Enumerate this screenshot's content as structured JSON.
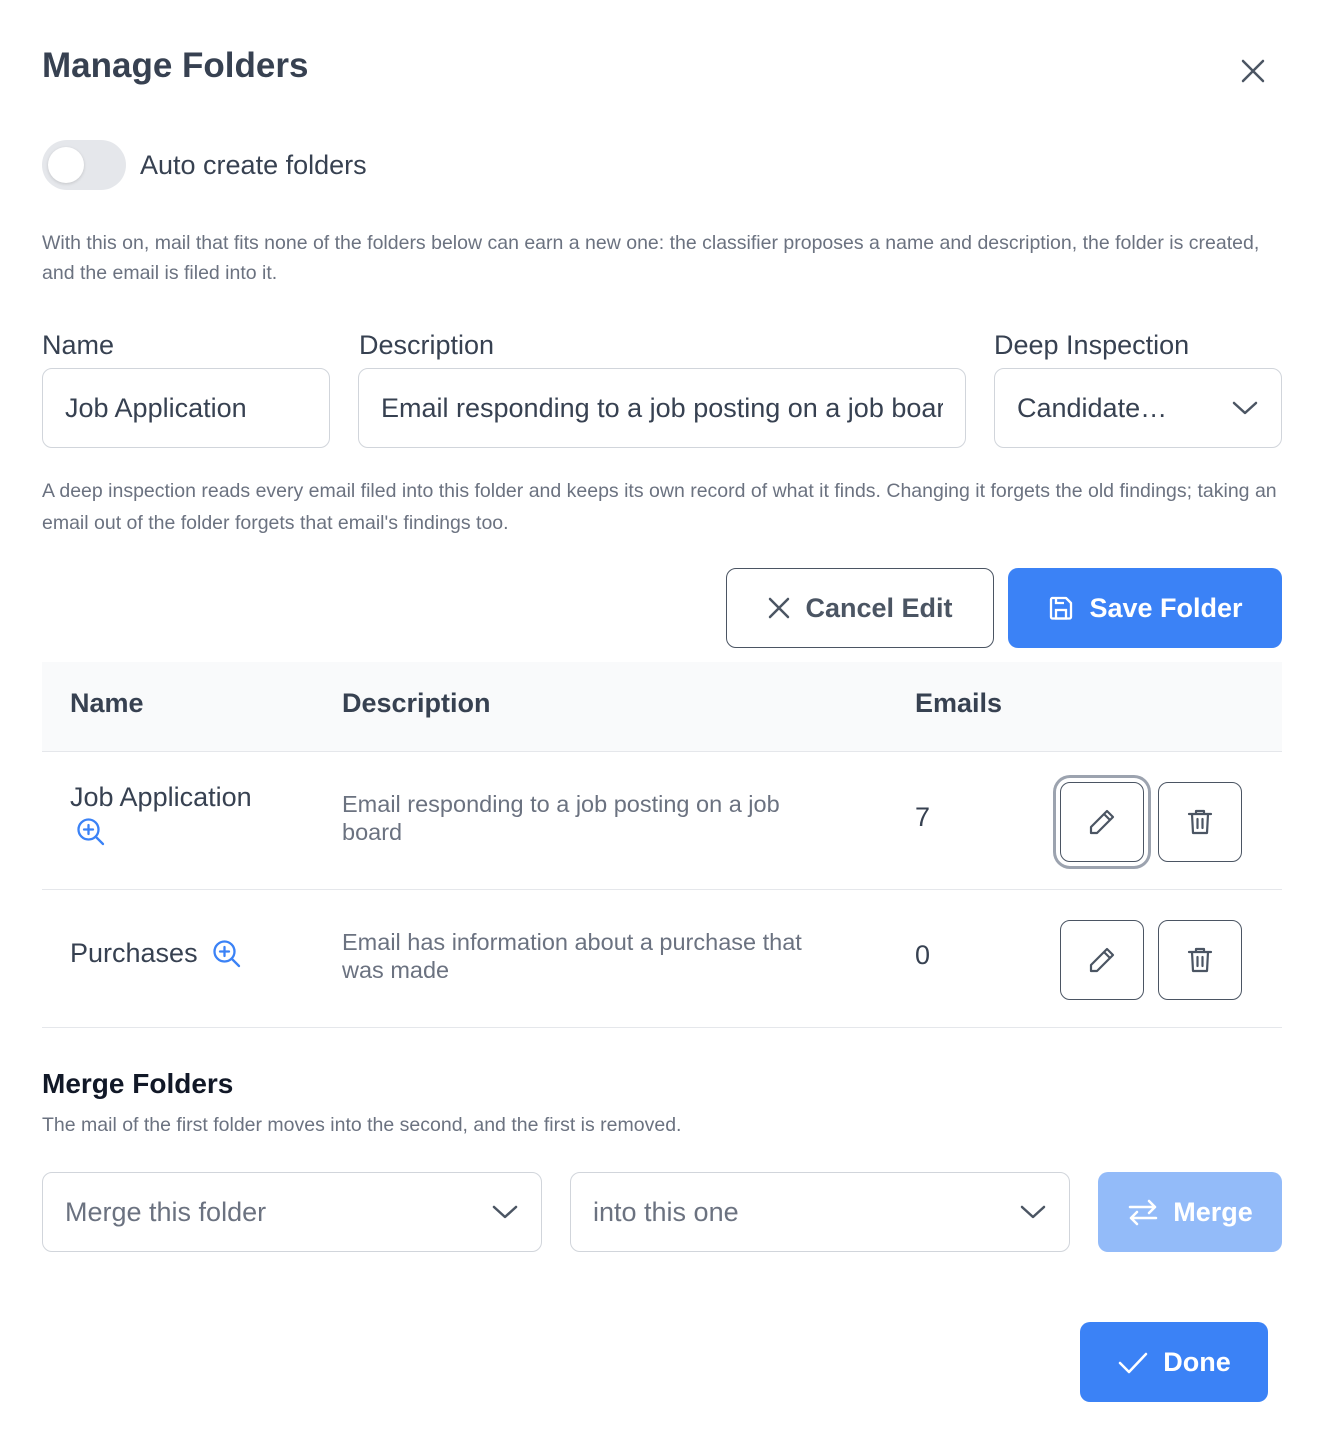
{
  "dialog": {
    "title": "Manage Folders"
  },
  "auto_create": {
    "label": "Auto create folders",
    "enabled": false,
    "help": "With this on, mail that fits none of the folders below can earn a new one: the classifier proposes a name and description, the folder is created, and the email is filed into it."
  },
  "form": {
    "name_label": "Name",
    "name_value": "Job Application",
    "description_label": "Description",
    "description_value": "Email responding to a job posting on a job board",
    "inspection_label": "Deep Inspection",
    "inspection_value": "Candidate…",
    "inspection_help": "A deep inspection reads every email filed into this folder and keeps its own record of what it finds. Changing it forgets the old findings; taking an email out of the folder forgets that email's findings too.",
    "cancel_label": "Cancel Edit",
    "save_label": "Save Folder"
  },
  "table": {
    "headers": {
      "name": "Name",
      "description": "Description",
      "emails": "Emails"
    },
    "rows": [
      {
        "name": "Job Application",
        "description": "Email responding to a job posting on a job board",
        "emails": "7"
      },
      {
        "name": "Purchases",
        "description": "Email has information about a purchase that was made",
        "emails": "0"
      }
    ]
  },
  "merge": {
    "title": "Merge Folders",
    "help": "The mail of the first folder moves into the second, and the first is removed.",
    "source_placeholder": "Merge this folder",
    "target_placeholder": "into this one",
    "button_label": "Merge"
  },
  "footer": {
    "done_label": "Done"
  },
  "colors": {
    "primary": "#3b82f6",
    "primary_disabled": "#93bbf9",
    "text": "#374151",
    "muted": "#6b7280",
    "border": "#d1d5db"
  }
}
